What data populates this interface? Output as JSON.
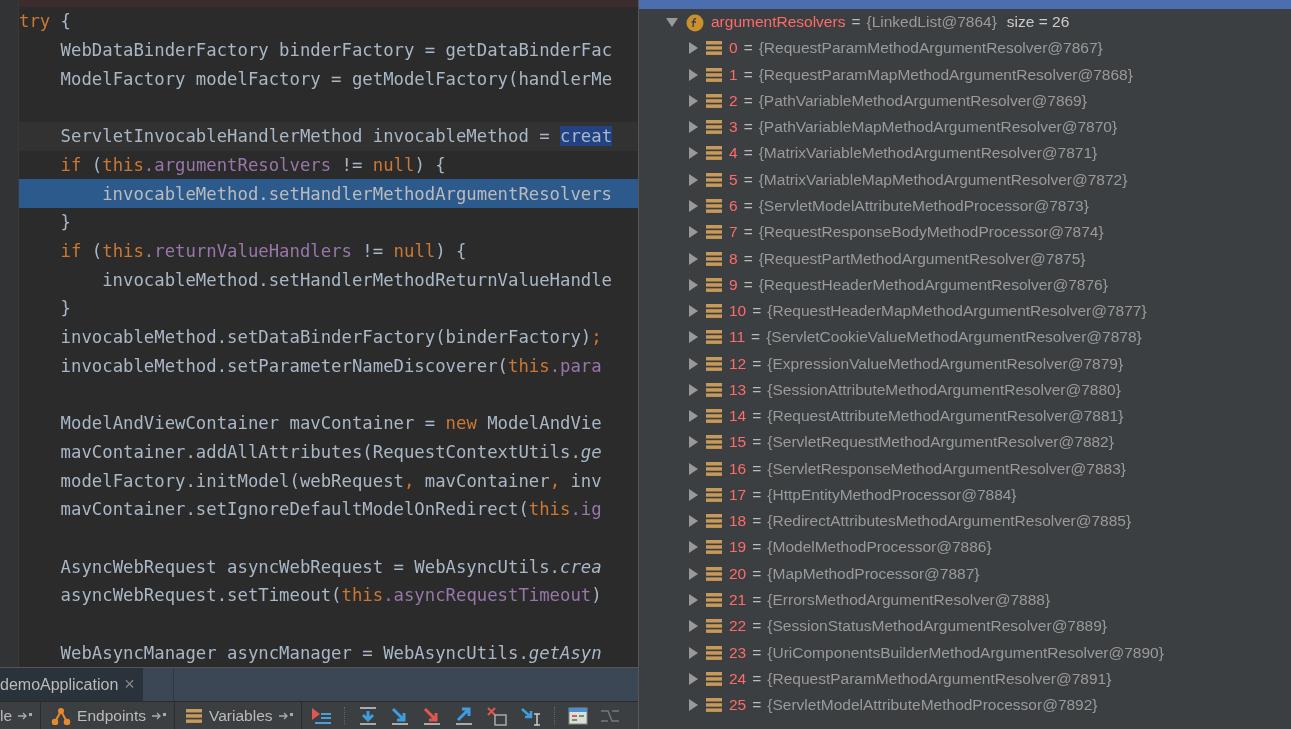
{
  "editor": {
    "lines": [
      {
        "kind": "normal",
        "tokens": [
          {
            "t": "try",
            "kind": "kw"
          },
          {
            "t": " {",
            "kind": "plain"
          }
        ],
        "children": [
          {
            "kind": "normal",
            "tokens": [
              {
                "t": "WebDataBinderFactory binderFactory = getDataBinderFac",
                "kind": "plain"
              }
            ]
          },
          {
            "kind": "normal",
            "tokens": [
              {
                "t": "ModelFactory modelFactory = getModelFactory(handlerMe",
                "kind": "plain"
              }
            ]
          },
          {
            "kind": "blank"
          },
          {
            "kind": "caret",
            "tokens": [
              {
                "t": "ServletInvocableHandlerMethod invocableMethod = ",
                "kind": "plain"
              },
              {
                "t": "creat",
                "kind": "sel"
              }
            ]
          },
          {
            "kind": "normal",
            "tokens": [
              {
                "t": "if",
                "kind": "kw"
              },
              {
                "t": " (",
                "kind": "plain"
              },
              {
                "t": "this",
                "kind": "kw"
              },
              {
                "t": ".argumentResolvers",
                "kind": "field"
              },
              {
                "t": " != ",
                "kind": "plain"
              },
              {
                "t": "null",
                "kind": "kw"
              },
              {
                "t": ") {",
                "kind": "plain"
              }
            ],
            "children": [
              {
                "kind": "execution",
                "tokens": [
                  {
                    "t": "invocableMethod.setHandlerMethodArgumentResolvers",
                    "kind": "plain"
                  }
                ]
              }
            ]
          },
          {
            "kind": "normal",
            "tokens": [
              {
                "t": "}",
                "kind": "plain"
              }
            ]
          },
          {
            "kind": "normal",
            "tokens": [
              {
                "t": "if",
                "kind": "kw"
              },
              {
                "t": " (",
                "kind": "plain"
              },
              {
                "t": "this",
                "kind": "kw"
              },
              {
                "t": ".returnValueHandlers",
                "kind": "field"
              },
              {
                "t": " != ",
                "kind": "plain"
              },
              {
                "t": "null",
                "kind": "kw"
              },
              {
                "t": ") {",
                "kind": "plain"
              }
            ],
            "children": [
              {
                "kind": "normal",
                "tokens": [
                  {
                    "t": "invocableMethod.setHandlerMethodReturnValueHandle",
                    "kind": "plain"
                  }
                ]
              }
            ]
          },
          {
            "kind": "normal",
            "tokens": [
              {
                "t": "}",
                "kind": "plain"
              }
            ]
          },
          {
            "kind": "normal",
            "tokens": [
              {
                "t": "invocableMethod.setDataBinderFactory(binderFactory)",
                "kind": "plain"
              },
              {
                "t": ";",
                "kind": "kw"
              }
            ]
          },
          {
            "kind": "normal",
            "tokens": [
              {
                "t": "invocableMethod.setParameterNameDiscoverer(",
                "kind": "plain"
              },
              {
                "t": "this",
                "kind": "kw"
              },
              {
                "t": ".para",
                "kind": "field"
              }
            ]
          },
          {
            "kind": "blank"
          },
          {
            "kind": "normal",
            "tokens": [
              {
                "t": "ModelAndViewContainer mavContainer = ",
                "kind": "plain"
              },
              {
                "t": "new",
                "kind": "kw"
              },
              {
                "t": " ModelAndVie",
                "kind": "plain"
              }
            ]
          },
          {
            "kind": "normal",
            "tokens": [
              {
                "t": "mavContainer.addAllAttributes(RequestContextUtils.",
                "kind": "plain"
              },
              {
                "t": "ge",
                "kind": "italic"
              }
            ]
          },
          {
            "kind": "normal",
            "tokens": [
              {
                "t": "modelFactory.initModel(webRequest",
                "kind": "plain"
              },
              {
                "t": ",",
                "kind": "kw"
              },
              {
                "t": " mavContainer",
                "kind": "plain"
              },
              {
                "t": ",",
                "kind": "kw"
              },
              {
                "t": " inv",
                "kind": "plain"
              }
            ]
          },
          {
            "kind": "normal",
            "tokens": [
              {
                "t": "mavContainer.setIgnoreDefaultModelOnRedirect(",
                "kind": "plain"
              },
              {
                "t": "this",
                "kind": "kw"
              },
              {
                "t": ".ig",
                "kind": "field"
              }
            ]
          },
          {
            "kind": "blank"
          },
          {
            "kind": "normal",
            "tokens": [
              {
                "t": "AsyncWebRequest asyncWebRequest = WebAsyncUtils.",
                "kind": "plain"
              },
              {
                "t": "crea",
                "kind": "italic"
              }
            ]
          },
          {
            "kind": "normal",
            "tokens": [
              {
                "t": "asyncWebRequest.setTimeout(",
                "kind": "plain"
              },
              {
                "t": "this",
                "kind": "kw"
              },
              {
                "t": ".asyncRequestTimeout",
                "kind": "field"
              },
              {
                "t": ")",
                "kind": "plain"
              }
            ]
          },
          {
            "kind": "blank"
          },
          {
            "kind": "normal",
            "tokens": [
              {
                "t": "WebAsyncManager asyncManager = WebAsyncUtils.",
                "kind": "plain"
              },
              {
                "t": "getAsyn",
                "kind": "italic"
              }
            ]
          }
        ]
      }
    ]
  },
  "run_tabs": [
    {
      "label": "demoApplication",
      "close": "×",
      "selected": true
    }
  ],
  "debug_toolbar": [
    {
      "label": "le"
    },
    {
      "label": "Endpoints"
    },
    {
      "label": "Variables"
    }
  ],
  "variables": [
    {
      "name": "argumentResolvers",
      "equals": "=",
      "value": "{LinkedList@7864}",
      "size": "size = 26",
      "expanded": true,
      "children": [
        {
          "name": "0",
          "equals": "=",
          "value": "{RequestParamMethodArgumentResolver@7867}",
          "expanded": false
        },
        {
          "name": "1",
          "equals": "=",
          "value": "{RequestParamMapMethodArgumentResolver@7868}",
          "expanded": false
        },
        {
          "name": "2",
          "equals": "=",
          "value": "{PathVariableMethodArgumentResolver@7869}",
          "expanded": false
        },
        {
          "name": "3",
          "equals": "=",
          "value": "{PathVariableMapMethodArgumentResolver@7870}",
          "expanded": false
        },
        {
          "name": "4",
          "equals": "=",
          "value": "{MatrixVariableMethodArgumentResolver@7871}",
          "expanded": false
        },
        {
          "name": "5",
          "equals": "=",
          "value": "{MatrixVariableMapMethodArgumentResolver@7872}",
          "expanded": false
        },
        {
          "name": "6",
          "equals": "=",
          "value": "{ServletModelAttributeMethodProcessor@7873}",
          "expanded": false
        },
        {
          "name": "7",
          "equals": "=",
          "value": "{RequestResponseBodyMethodProcessor@7874}",
          "expanded": false
        },
        {
          "name": "8",
          "equals": "=",
          "value": "{RequestPartMethodArgumentResolver@7875}",
          "expanded": false
        },
        {
          "name": "9",
          "equals": "=",
          "value": "{RequestHeaderMethodArgumentResolver@7876}",
          "expanded": false
        },
        {
          "name": "10",
          "equals": "=",
          "value": "{RequestHeaderMapMethodArgumentResolver@7877}",
          "expanded": false
        },
        {
          "name": "11",
          "equals": "=",
          "value": "{ServletCookieValueMethodArgumentResolver@7878}",
          "expanded": false
        },
        {
          "name": "12",
          "equals": "=",
          "value": "{ExpressionValueMethodArgumentResolver@7879}",
          "expanded": false
        },
        {
          "name": "13",
          "equals": "=",
          "value": "{SessionAttributeMethodArgumentResolver@7880}",
          "expanded": false
        },
        {
          "name": "14",
          "equals": "=",
          "value": "{RequestAttributeMethodArgumentResolver@7881}",
          "expanded": false
        },
        {
          "name": "15",
          "equals": "=",
          "value": "{ServletRequestMethodArgumentResolver@7882}",
          "expanded": false
        },
        {
          "name": "16",
          "equals": "=",
          "value": "{ServletResponseMethodArgumentResolver@7883}",
          "expanded": false
        },
        {
          "name": "17",
          "equals": "=",
          "value": "{HttpEntityMethodProcessor@7884}",
          "expanded": false
        },
        {
          "name": "18",
          "equals": "=",
          "value": "{RedirectAttributesMethodArgumentResolver@7885}",
          "expanded": false
        },
        {
          "name": "19",
          "equals": "=",
          "value": "{ModelMethodProcessor@7886}",
          "expanded": false
        },
        {
          "name": "20",
          "equals": "=",
          "value": "{MapMethodProcessor@7887}",
          "expanded": false
        },
        {
          "name": "21",
          "equals": "=",
          "value": "{ErrorsMethodArgumentResolver@7888}",
          "expanded": false
        },
        {
          "name": "22",
          "equals": "=",
          "value": "{SessionStatusMethodArgumentResolver@7889}",
          "expanded": false
        },
        {
          "name": "23",
          "equals": "=",
          "value": "{UriComponentsBuilderMethodArgumentResolver@7890}",
          "expanded": false
        },
        {
          "name": "24",
          "equals": "=",
          "value": "{RequestParamMethodArgumentResolver@7891}",
          "expanded": false
        },
        {
          "name": "25",
          "equals": "=",
          "value": "{ServletModelAttributeMethodProcessor@7892}",
          "expanded": false
        }
      ]
    }
  ]
}
